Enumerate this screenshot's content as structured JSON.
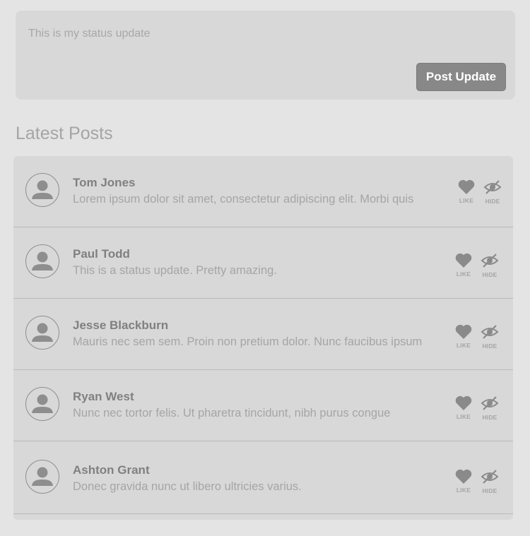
{
  "composer": {
    "placeholder": "This is my status update",
    "post_button_label": "Post Update"
  },
  "section_title": "Latest Posts",
  "posts": [
    {
      "name": "Tom Jones",
      "text": "Lorem ipsum dolor sit amet, consectetur adipiscing elit. Morbi quis",
      "like_label": "LIKE",
      "hide_label": "HIDE"
    },
    {
      "name": "Paul Todd",
      "text": "This is a status update. Pretty amazing.",
      "like_label": "LIKE",
      "hide_label": "HIDE"
    },
    {
      "name": "Jesse Blackburn",
      "text": "Mauris nec sem sem. Proin non pretium dolor. Nunc faucibus ipsum",
      "like_label": "LIKE",
      "hide_label": "HIDE"
    },
    {
      "name": "Ryan West",
      "text": "Nunc nec tortor felis. Ut pharetra tincidunt, nibh purus congue",
      "like_label": "LIKE",
      "hide_label": "HIDE"
    },
    {
      "name": "Ashton Grant",
      "text": "Donec gravida nunc ut libero ultricies varius.",
      "like_label": "LIKE",
      "hide_label": "HIDE"
    }
  ],
  "icons": {
    "avatar": "user-silhouette-icon",
    "like": "heart-icon",
    "hide": "eye-slash-icon"
  },
  "colors": {
    "page_background": "#e4e4e4",
    "card_background": "#d8d8d8",
    "button_background": "#888888",
    "icon_color": "#8a8a8a"
  }
}
